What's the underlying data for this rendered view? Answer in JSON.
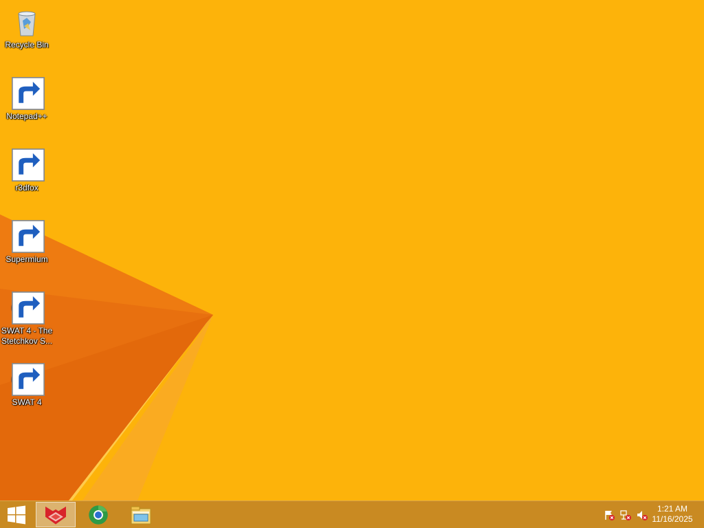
{
  "desktop": {
    "background_color": "#fdb30a",
    "icons": [
      {
        "label": "Recycle Bin",
        "icon": "recycle-bin-icon",
        "shortcut": false
      },
      {
        "label": "Notepad++",
        "icon": "notepad-plus-plus-icon",
        "shortcut": true
      },
      {
        "label": "r3dfox",
        "icon": "r3dfox-icon",
        "shortcut": true
      },
      {
        "label": "Supermium",
        "icon": "supermium-icon",
        "shortcut": true
      },
      {
        "label": "SWAT 4 - The Stetchkov S...",
        "icon": "swat4-icon",
        "shortcut": true
      },
      {
        "label": "SWAT 4",
        "icon": "swat4-icon",
        "shortcut": true
      }
    ]
  },
  "taskbar": {
    "background_color": "#c98a22",
    "start": {
      "icon": "windows-logo-icon"
    },
    "pinned": [
      {
        "icon": "r3dfox-icon",
        "active": true
      },
      {
        "icon": "supermium-icon",
        "active": false
      },
      {
        "icon": "file-explorer-icon",
        "active": false
      }
    ],
    "tray": {
      "icons": [
        "action-center-flag-icon",
        "network-icon",
        "volume-muted-icon"
      ],
      "time": "1:21 AM",
      "date": "11/16/2025"
    }
  }
}
